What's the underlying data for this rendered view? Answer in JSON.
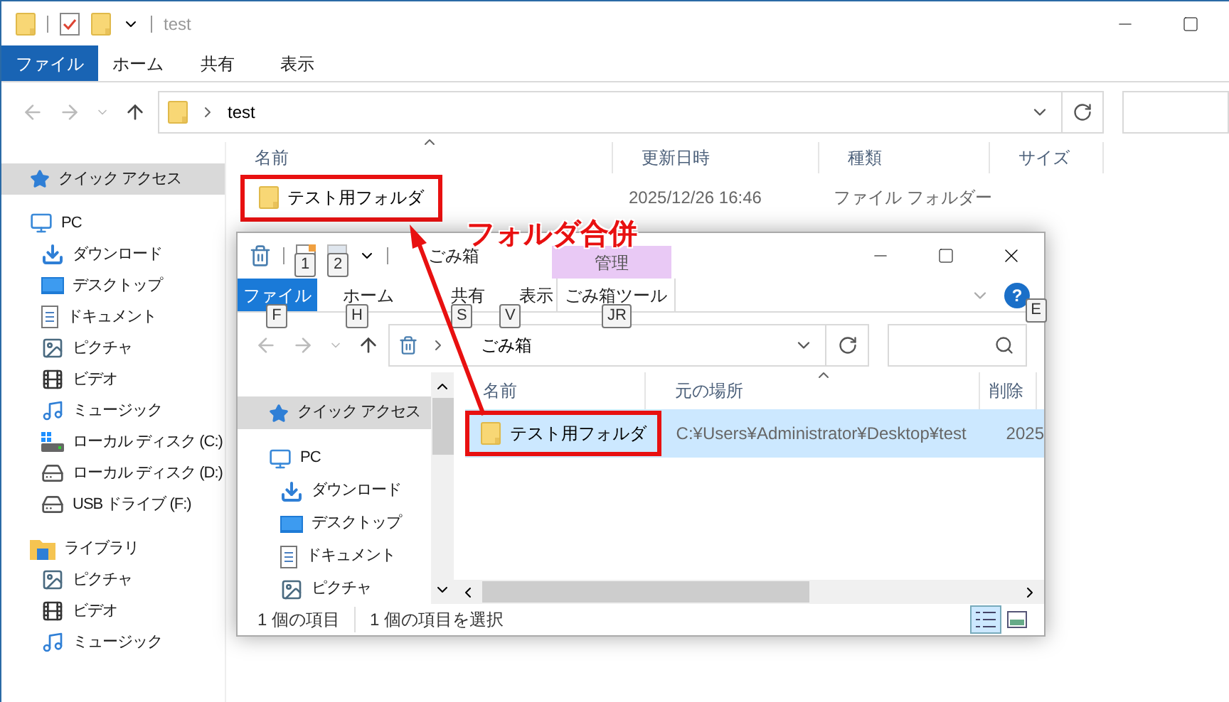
{
  "back_window": {
    "title": "test",
    "ribbon_tabs": [
      {
        "label": "ファイル",
        "selected": true
      },
      {
        "label": "ホーム",
        "selected": false
      },
      {
        "label": "共有",
        "selected": false
      },
      {
        "label": "表示",
        "selected": false
      }
    ],
    "address": {
      "path": "test"
    },
    "sidebar": {
      "items": [
        {
          "label": "クイック アクセス",
          "kind": "star",
          "selected": true
        },
        {
          "label": "PC",
          "kind": "pc",
          "selected": false,
          "children": [
            {
              "label": "ダウンロード",
              "kind": "download",
              "selected": false
            },
            {
              "label": "デスクトップ",
              "kind": "desktop",
              "selected": false
            },
            {
              "label": "ドキュメント",
              "kind": "document",
              "selected": false
            },
            {
              "label": "ピクチャ",
              "kind": "picture",
              "selected": false
            },
            {
              "label": "ビデオ",
              "kind": "video",
              "selected": false
            },
            {
              "label": "ミュージック",
              "kind": "music",
              "selected": false
            },
            {
              "label": "ローカル ディスク (C:)",
              "kind": "system-disk",
              "selected": false
            },
            {
              "label": "ローカル ディスク (D:)",
              "kind": "disk",
              "selected": false
            },
            {
              "label": "USB ドライブ (F:)",
              "kind": "disk",
              "selected": false
            }
          ]
        },
        {
          "label": "ライブラリ",
          "kind": "library",
          "selected": false,
          "children": [
            {
              "label": "ピクチャ",
              "kind": "picture",
              "selected": false
            },
            {
              "label": "ビデオ",
              "kind": "video",
              "selected": false
            },
            {
              "label": "ミュージック",
              "kind": "music",
              "selected": false
            }
          ]
        }
      ]
    },
    "file_list": {
      "columns": [
        "名前",
        "更新日時",
        "種類",
        "サイズ"
      ],
      "rows": [
        {
          "name": "テスト用フォルダ",
          "modified": "2025/12/26 16:46",
          "type": "ファイル フォルダー",
          "selected": false,
          "marked": true
        }
      ]
    }
  },
  "front_window": {
    "title": "ごみ箱",
    "quick_access_hotkeys": [
      "1",
      "2"
    ],
    "ribbon_tabs": [
      {
        "label": "ファイル",
        "hotkey": "F",
        "selected": true
      },
      {
        "label": "ホーム",
        "hotkey": "H",
        "selected": false
      },
      {
        "label": "共有",
        "hotkey": "S",
        "selected": false
      },
      {
        "label": "表示",
        "hotkey": "V",
        "selected": false
      }
    ],
    "context_tab": {
      "group": "管理",
      "label": "ごみ箱ツール",
      "hotkey": "JR",
      "selected": false
    },
    "help_hotkey": "E",
    "help_label": "?",
    "address": {
      "path": "ごみ箱"
    },
    "sidebar": {
      "items": [
        {
          "label": "クイック アクセス",
          "kind": "star",
          "selected": true
        },
        {
          "label": "PC",
          "kind": "pc",
          "selected": false,
          "children": [
            {
              "label": "ダウンロード",
              "kind": "download",
              "selected": false
            },
            {
              "label": "デスクトップ",
              "kind": "desktop",
              "selected": false
            },
            {
              "label": "ドキュメント",
              "kind": "document",
              "selected": false
            },
            {
              "label": "ピクチャ",
              "kind": "picture",
              "selected": false
            }
          ]
        }
      ]
    },
    "file_list": {
      "columns": [
        "名前",
        "元の場所",
        "削除"
      ],
      "rows": [
        {
          "name": "テスト用フォルダ",
          "location": "C:¥Users¥Administrator¥Desktop¥test",
          "deleted": "2025",
          "selected": true,
          "marked": true
        }
      ]
    },
    "status_bar": [
      "1 個の項目",
      "1 個の項目を選択"
    ]
  },
  "annotation": {
    "label": "フォルダ合併"
  }
}
